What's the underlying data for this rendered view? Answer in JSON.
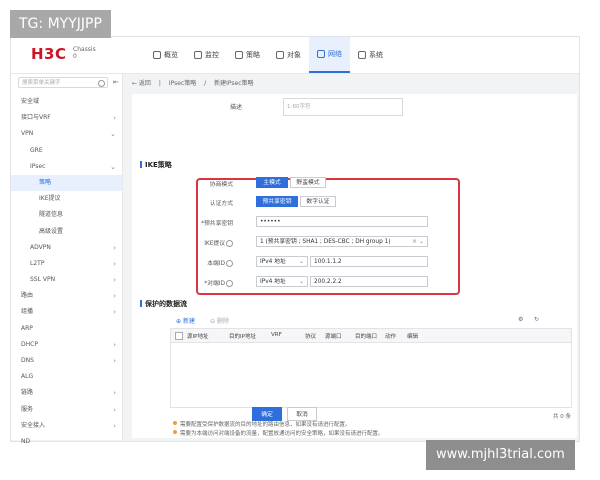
{
  "header": {
    "logo": "H3C",
    "chassis_line1": "Chassis",
    "chassis_line2": "0"
  },
  "nav": [
    {
      "label": "概览",
      "active": false
    },
    {
      "label": "监控",
      "active": false
    },
    {
      "label": "策略",
      "active": false
    },
    {
      "label": "对象",
      "active": false
    },
    {
      "label": "网络",
      "active": true
    },
    {
      "label": "系统",
      "active": false
    }
  ],
  "sidebar": {
    "search_placeholder": "搜索菜单关键字",
    "items": [
      {
        "label": "安全域",
        "indent": 0,
        "arrow": "",
        "selected": false
      },
      {
        "label": "接口与VRF",
        "indent": 0,
        "arrow": "›",
        "selected": false
      },
      {
        "label": "VPN",
        "indent": 0,
        "arrow": "⌄",
        "selected": false
      },
      {
        "label": "GRE",
        "indent": 1,
        "arrow": "",
        "selected": false
      },
      {
        "label": "IPsec",
        "indent": 1,
        "arrow": "⌄",
        "selected": false
      },
      {
        "label": "策略",
        "indent": 2,
        "arrow": "",
        "selected": true
      },
      {
        "label": "IKE提议",
        "indent": 2,
        "arrow": "",
        "selected": false
      },
      {
        "label": "隧道信息",
        "indent": 2,
        "arrow": "",
        "selected": false
      },
      {
        "label": "高级设置",
        "indent": 2,
        "arrow": "",
        "selected": false
      },
      {
        "label": "ADVPN",
        "indent": 1,
        "arrow": "›",
        "selected": false
      },
      {
        "label": "L2TP",
        "indent": 1,
        "arrow": "›",
        "selected": false
      },
      {
        "label": "SSL VPN",
        "indent": 1,
        "arrow": "›",
        "selected": false
      },
      {
        "label": "路由",
        "indent": 0,
        "arrow": "›",
        "selected": false
      },
      {
        "label": "组播",
        "indent": 0,
        "arrow": "›",
        "selected": false
      },
      {
        "label": "ARP",
        "indent": 0,
        "arrow": "",
        "selected": false
      },
      {
        "label": "DHCP",
        "indent": 0,
        "arrow": "›",
        "selected": false
      },
      {
        "label": "DNS",
        "indent": 0,
        "arrow": "›",
        "selected": false
      },
      {
        "label": "ALG",
        "indent": 0,
        "arrow": "",
        "selected": false
      },
      {
        "label": "链路",
        "indent": 0,
        "arrow": "›",
        "selected": false
      },
      {
        "label": "服务",
        "indent": 0,
        "arrow": "›",
        "selected": false
      },
      {
        "label": "安全接入",
        "indent": 0,
        "arrow": "›",
        "selected": false
      },
      {
        "label": "ND",
        "indent": 0,
        "arrow": "",
        "selected": false
      }
    ]
  },
  "breadcrumb": {
    "back": "← 返回",
    "level1": "IPsec策略",
    "sep": "/",
    "level2": "新建IPsec策略"
  },
  "form": {
    "desc_label": "描述",
    "desc_placeholder": "1-80字符",
    "ike_section": "IKE策略",
    "mode_label": "协商模式",
    "mode_main": "主模式",
    "mode_aggressive": "野蛮模式",
    "auth_label": "认证方式",
    "auth_psk": "预共享密钥",
    "auth_cert": "数字认证",
    "psk_label": "*预共享密钥",
    "psk_value": "••••••",
    "proposal_label": "IKE提议",
    "proposal_value": "1 (预共享密钥 ; SHA1 ; DES-CBC ; DH group 1)",
    "local_id_label": "本端ID",
    "local_id_type": "IPv4 地址",
    "local_id_value": "100.1.1.2",
    "peer_id_label": "*对端ID",
    "peer_id_type": "IPv4 地址",
    "peer_id_value": "200.2.2.2"
  },
  "flow": {
    "section": "保护的数据流",
    "new": "新建",
    "delete": "删除",
    "columns": [
      "源IP地址",
      "目的IP地址",
      "VRF",
      "协议",
      "源端口",
      "目的端口",
      "动作",
      "编辑"
    ],
    "total": "共 0 条",
    "note1": "需要配置受保护数据流的目的地址的路由信息，如果没有请进行配置。",
    "note2": "需要为本端访问对端设备的流量，配置放通访问的安全策略，如果没有请进行配置。"
  },
  "actions": {
    "ok": "确定",
    "cancel": "取消"
  },
  "watermarks": {
    "top_left": "TG: MYYJJPP",
    "bottom_right": "www.mjhl3trial.com"
  },
  "colors": {
    "accent": "#2f6fdc",
    "highlight_border": "#d9363e",
    "brand": "#cf1322"
  }
}
